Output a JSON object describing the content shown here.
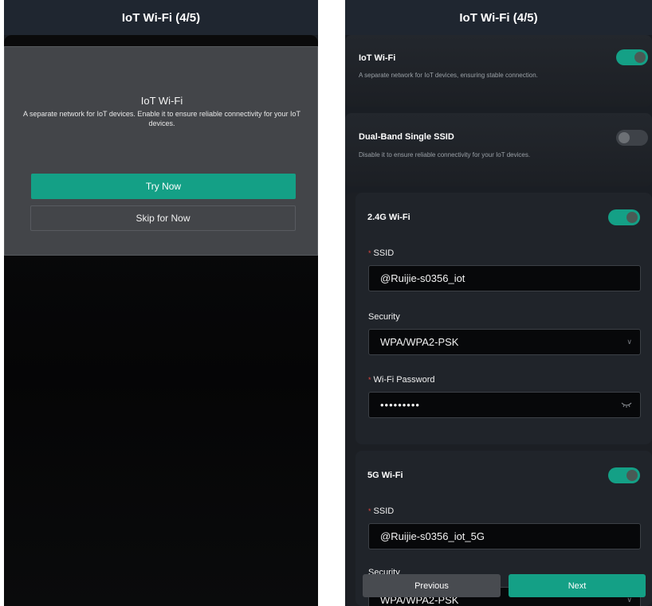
{
  "left": {
    "title": "IoT Wi-Fi (4/5)",
    "modal": {
      "title": "IoT Wi-Fi",
      "description": "A separate network for IoT devices. Enable it to ensure reliable connectivity for your IoT devices.",
      "primary_button": "Try Now",
      "secondary_button": "Skip for Now"
    }
  },
  "right": {
    "title": "IoT Wi-Fi (4/5)",
    "iot_wifi": {
      "title": "IoT Wi-Fi",
      "description": "A separate network for IoT devices, ensuring stable connection.",
      "enabled": true
    },
    "dual_band": {
      "title": "Dual-Band Single SSID",
      "description": "Disable it to ensure reliable connectivity for your IoT devices.",
      "enabled": false
    },
    "wifi_24g": {
      "title": "2.4G Wi-Fi",
      "enabled": true,
      "ssid_label": "SSID",
      "ssid_value": "@Ruijie-s0356_iot",
      "security_label": "Security",
      "security_value": "WPA/WPA2-PSK",
      "password_label": "Wi-Fi Password",
      "password_value": "•••••••••"
    },
    "wifi_5g": {
      "title": "5G Wi-Fi",
      "enabled": true,
      "ssid_label": "SSID",
      "ssid_value": "@Ruijie-s0356_iot_5G",
      "security_label": "Security",
      "security_value": "WPA/WPA2-PSK"
    },
    "footer": {
      "previous": "Previous",
      "next": "Next"
    }
  },
  "colors": {
    "accent": "#14a086",
    "required": "#e0463f"
  }
}
